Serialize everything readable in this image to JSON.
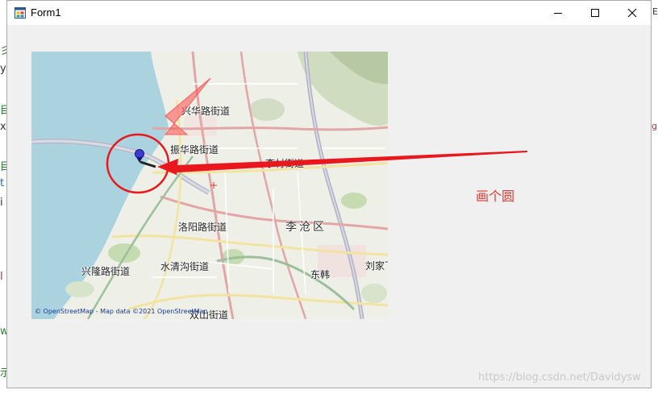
{
  "window": {
    "title": "Form1"
  },
  "background": {
    "left_glyphs": [
      "彡",
      "y",
      "目",
      "x",
      "目",
      "t",
      "i",
      "l",
      "w",
      "示"
    ],
    "right_glyphs": [
      "Ev",
      "g"
    ]
  },
  "map": {
    "labels": {
      "xinghua": "兴华路街道",
      "zhenhua": "振华路街道",
      "licun": "李村街道",
      "luoyang": "洛阳路街道",
      "district": "李沧区",
      "xinglong": "兴隆路街道",
      "shuiqinggou": "水清沟街道",
      "donghan": "东韩",
      "liujia": "刘家下",
      "shuangshan": "双山街道"
    },
    "attribution": "© OpenStreetMap - Map data ©2021 OpenStreetMap"
  },
  "annotation": {
    "text": "画个圆"
  },
  "watermark": "https://blog.csdn.net/Davidysw",
  "colors": {
    "water": "#aad3df",
    "annotation_red": "#e53935",
    "marker_blue": "#3b3bd6"
  }
}
